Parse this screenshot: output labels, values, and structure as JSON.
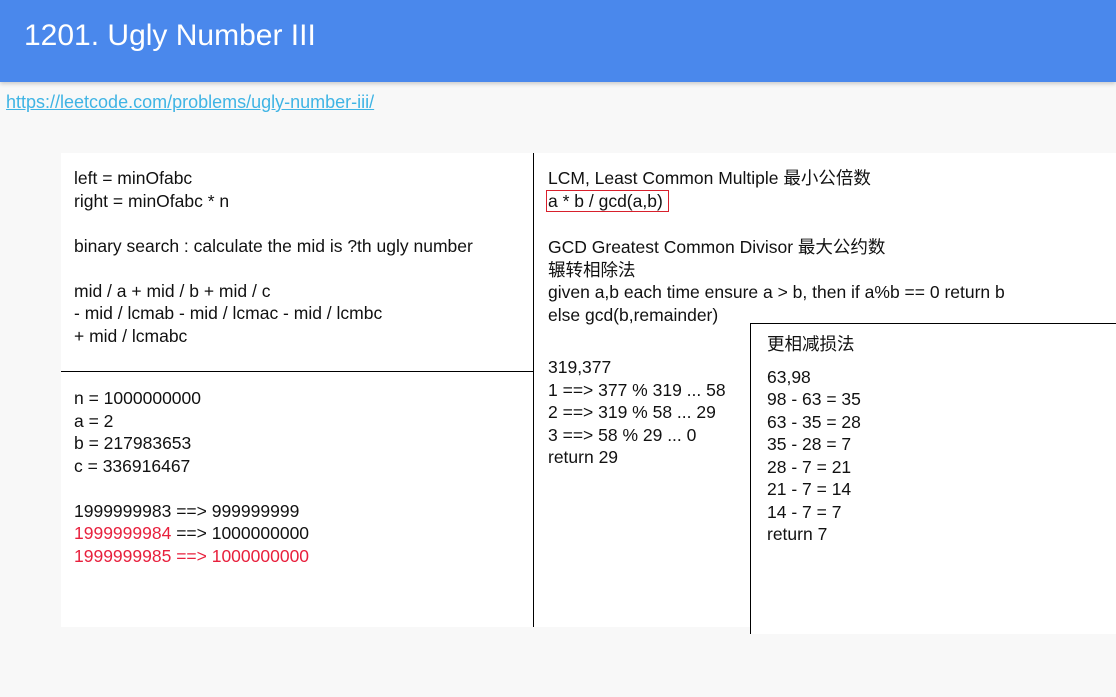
{
  "header": {
    "title": "1201. Ugly Number III",
    "background": "#4a88ec"
  },
  "link": {
    "text": "https://leetcode.com/problems/ugly-number-iii/",
    "color": "#3fb4e4"
  },
  "left_top": {
    "lines": [
      "left = minOfabc",
      "right = minOfabc * n",
      "binary search : calculate the mid is ?th ugly number",
      "mid / a + mid / b + mid / c",
      "- mid / lcmab - mid / lcmac - mid / lcmbc",
      "+ mid / lcmabc"
    ]
  },
  "left_bottom": {
    "lines": [
      "n = 1000000000",
      "a = 2",
      "b = 217983653",
      "c = 336916467",
      "1999999983 ==> 999999999",
      "1999999984",
      " ==> 1000000000",
      "1999999985 ==> 1000000000"
    ]
  },
  "right_top": {
    "lines": [
      "LCM, Least Common Multiple 最小公倍数",
      "a * b / gcd(a,b)",
      "GCD Greatest Common Divisor 最大公约数",
      " 辗转相除法",
      "given a,b each time ensure a > b, then if a%b == 0 return b",
      "else gcd(b,remainder)"
    ]
  },
  "right_bottom": {
    "lines": [
      "319,377",
      "1 ==> 377 % 319 ... 58",
      "2 ==> 319 % 58 ... 29",
      "3 ==> 58 % 29 ... 0",
      "return 29"
    ]
  },
  "inner_panel": {
    "title": "更相减损法",
    "lines": [
      "63,98",
      "98 - 63 = 35",
      "63 - 35 = 28",
      "35 - 28 = 7",
      "28 - 7 = 21",
      "21 - 7 = 14",
      "14 - 7 = 7",
      "return 7"
    ]
  },
  "colors": {
    "highlight_red": "#e8203d",
    "box_border": "#d8202c"
  }
}
